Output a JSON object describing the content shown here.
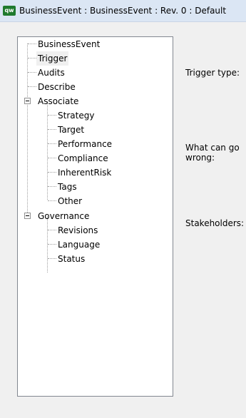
{
  "window": {
    "icon_text": "qw",
    "title": "BusinessEvent : BusinessEvent : Rev. 0 : Default"
  },
  "tree": {
    "root": "BusinessEvent",
    "items": {
      "trigger": "Trigger",
      "audits": "Audits",
      "describe": "Describe",
      "associate": "Associate",
      "strategy": "Strategy",
      "target": "Target",
      "performance": "Performance",
      "compliance": "Compliance",
      "inherent_risk": "InherentRisk",
      "tags": "Tags",
      "other": "Other",
      "governance": "Governance",
      "revisions": "Revisions",
      "language": "Language",
      "status": "Status"
    },
    "selected": "Trigger"
  },
  "form": {
    "trigger_type_label": "Trigger type:",
    "what_can_go_wrong_line1": "What can go",
    "what_can_go_wrong_line2": "wrong:",
    "stakeholders_label": "Stakeholders:"
  }
}
